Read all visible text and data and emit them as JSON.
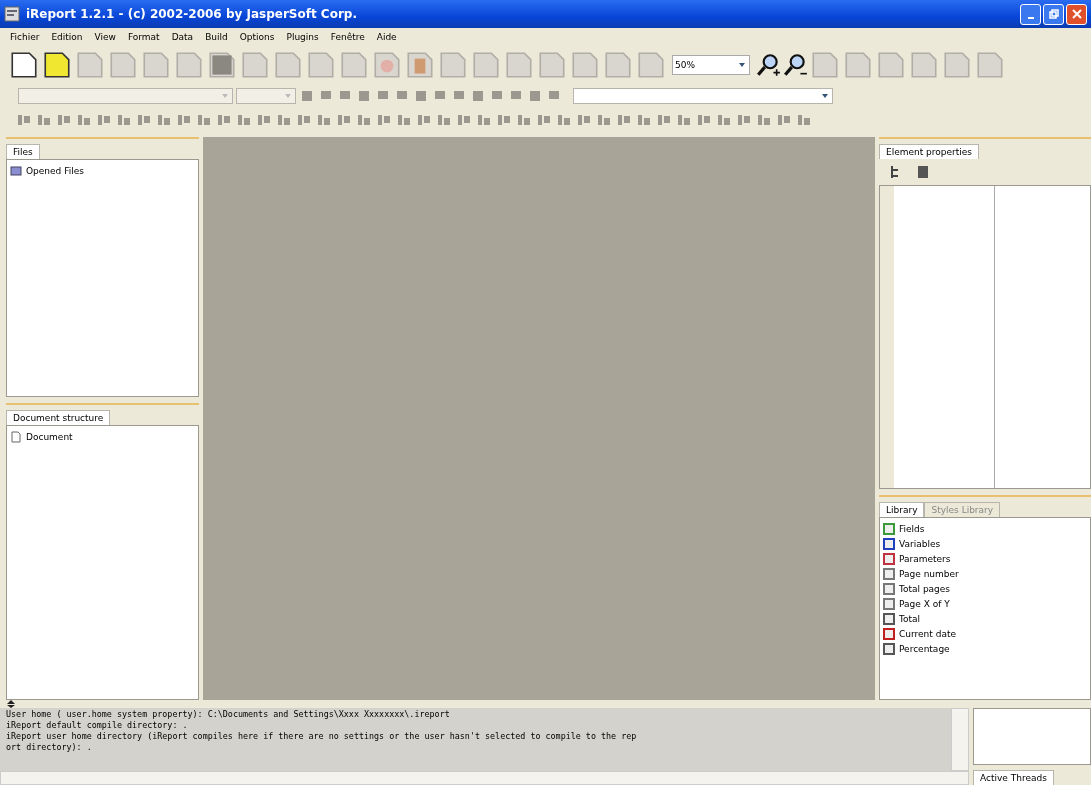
{
  "window": {
    "title": "iReport 1.2.1  - (c) 2002-2006 by JasperSoft Corp."
  },
  "menu": [
    "Fichier",
    "Edition",
    "View",
    "Format",
    "Data",
    "Build",
    "Options",
    "Plugins",
    "Fenêtre",
    "Aide"
  ],
  "toolbar": {
    "zoom": "50%"
  },
  "files_panel": {
    "tab": "Files",
    "items": [
      "Opened Files"
    ]
  },
  "structure_panel": {
    "tab": "Document structure",
    "items": [
      "Document"
    ]
  },
  "properties_panel": {
    "tab": "Element properties"
  },
  "library_panel": {
    "tabs": [
      {
        "label": "Library",
        "selected": true
      },
      {
        "label": "Styles Library",
        "selected": false
      }
    ],
    "items": [
      "Fields",
      "Variables",
      "Parameters",
      "Page number",
      "Total pages",
      "Page X of Y",
      "Total",
      "Current date",
      "Percentage"
    ]
  },
  "log": {
    "lines": [
      "User home ( user.home system property): C:\\Documents and Settings\\Xxxx Xxxxxxxx\\.ireport",
      "iReport default compile directory: .",
      "iReport user home directory (iReport compiles here if there are no settings or the user hasn't selected to compile to the rep",
      "ort directory): ."
    ]
  },
  "threads_panel": {
    "tab": "Active Threads"
  }
}
